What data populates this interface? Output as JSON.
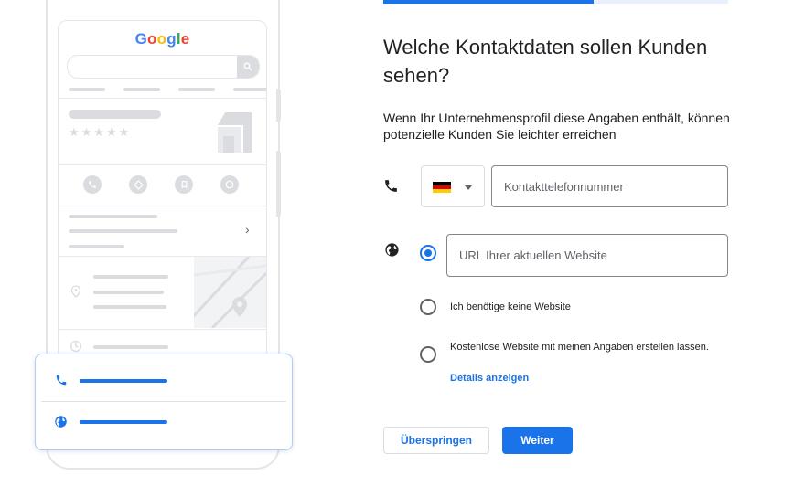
{
  "progress": {
    "fraction": 0.61
  },
  "illustration": {
    "logo": {
      "letters": [
        {
          "char": "G",
          "color": "#4285f4"
        },
        {
          "char": "o",
          "color": "#ea4335"
        },
        {
          "char": "o",
          "color": "#fbbc05"
        },
        {
          "char": "g",
          "color": "#4285f4"
        },
        {
          "char": "l",
          "color": "#34a853"
        },
        {
          "char": "e",
          "color": "#ea4335"
        }
      ]
    },
    "rating_stars": "★★★★★",
    "chevron": "›"
  },
  "form": {
    "title": "Welche Kontaktdaten sollen Kunden sehen?",
    "description": "Wenn Ihr Unternehmensprofil diese Angaben enthält, können potenzielle Kunden Sie leichter erreichen",
    "phone": {
      "icon": "phone-icon",
      "country_flag": "de-flag",
      "flag_colors": [
        "#000000",
        "#dd0000",
        "#ffce00"
      ],
      "placeholder": "Kontakttelefonnummer",
      "value": ""
    },
    "website": {
      "icon": "globe-icon",
      "placeholder": "URL Ihrer aktuellen Website",
      "value": "",
      "options": [
        {
          "label": "",
          "checked": true
        },
        {
          "label": "Ich benötige keine Website",
          "checked": false
        },
        {
          "label": "Kostenlose Website mit meinen Angaben erstellen lassen.",
          "checked": false,
          "link": "Details anzeigen"
        }
      ]
    }
  },
  "buttons": {
    "skip": "Überspringen",
    "next": "Weiter"
  },
  "colors": {
    "accent": "#1a73e8",
    "placeholder_gray": "#dadce0"
  }
}
